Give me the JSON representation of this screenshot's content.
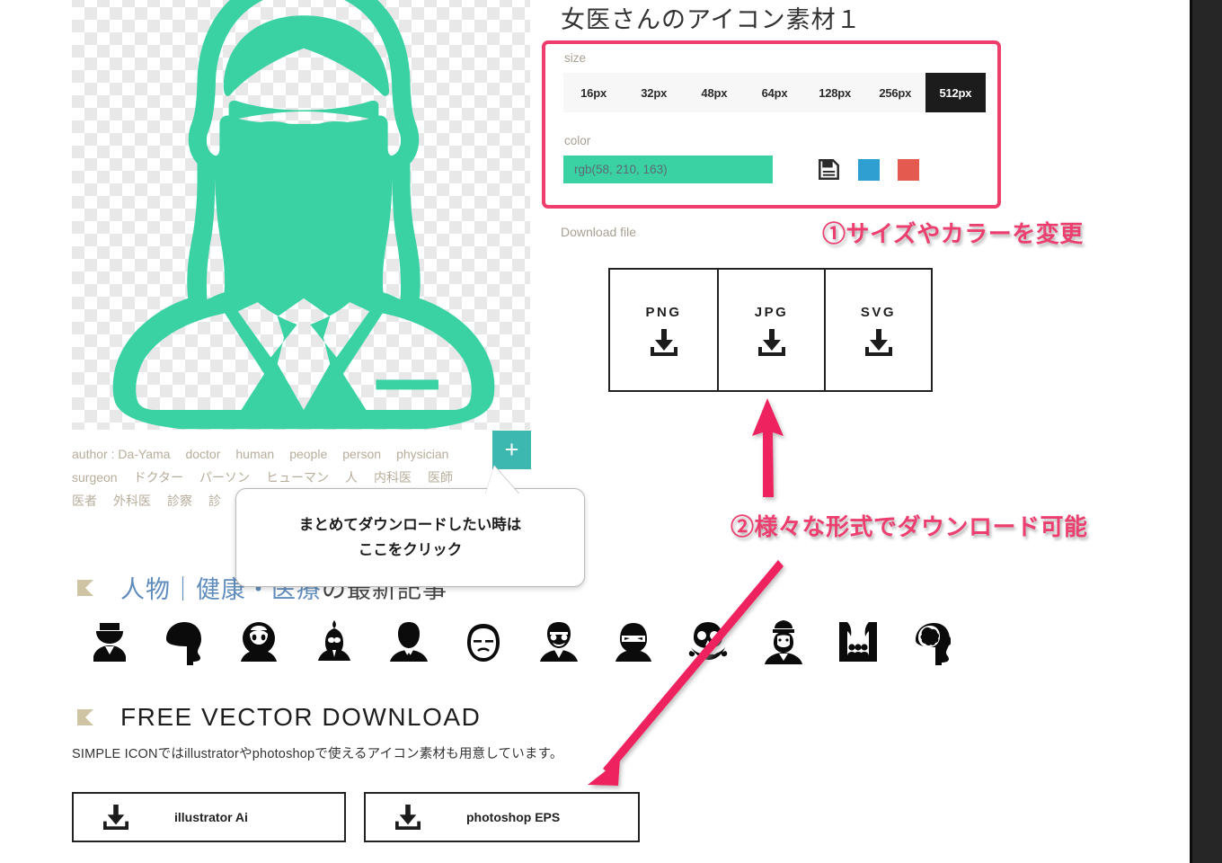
{
  "page": {
    "title": "女医さんのアイコン素材１"
  },
  "preview": {
    "icon_name": "female-doctor-icon",
    "icon_color": "#3ad2a3",
    "add_button_label": "+"
  },
  "options": {
    "size_label": "size",
    "sizes": [
      "16px",
      "32px",
      "48px",
      "64px",
      "128px",
      "256px",
      "512px"
    ],
    "selected_size": "512px",
    "color_label": "color",
    "color_value": "rgb(58, 210, 163)",
    "color_hex": "#3ad2a3",
    "swatches": [
      {
        "name": "save-icon",
        "type": "icon"
      },
      {
        "name": "blue-swatch",
        "hex": "#2e9fd0"
      },
      {
        "name": "red-swatch",
        "hex": "#e45a4f"
      }
    ],
    "border_accent": "#ef3d6e"
  },
  "download": {
    "label": "Download file",
    "formats": [
      "PNG",
      "JPG",
      "SVG"
    ]
  },
  "tags": {
    "row1": [
      "author : Da-Yama",
      "doctor",
      "human",
      "people",
      "person",
      "physician"
    ],
    "row2": [
      "surgeon",
      "ドクター",
      "パーソン",
      "ヒューマン",
      "人",
      "内科医",
      "医師"
    ],
    "row3": [
      "医者",
      "外科医",
      "診察",
      "診"
    ]
  },
  "tooltip": {
    "line1": "まとめてダウンロードしたい時は",
    "line2": "ここをクリック"
  },
  "sections": {
    "articles_heading_link": "人物｜健康・医療",
    "articles_heading_tail": "の最新記事",
    "vector_heading": "FREE VECTOR DOWNLOAD",
    "vector_desc": "SIMPLE ICONではillustratorやphotoshopで使えるアイコン素材も用意しています。"
  },
  "icon_strip": [
    "surgeon-cap-icon",
    "head-silhouette-icon",
    "hooded-person-icon",
    "bun-hair-glasses-icon",
    "businessman-icon",
    "bald-old-man-icon",
    "mustache-glasses-man-icon",
    "ninja-icon",
    "skull-crossbones-icon",
    "soldier-icon",
    "stage-audience-icon",
    "brain-head-icon"
  ],
  "vector_buttons": [
    {
      "label": "illustrator Ai",
      "icon": "download-icon"
    },
    {
      "label": "photoshop EPS",
      "icon": "download-icon"
    }
  ],
  "annotations": {
    "one": "①サイズやカラーを変更",
    "two": "②様々な形式でダウンロード可能",
    "color": "#ec3f70"
  }
}
